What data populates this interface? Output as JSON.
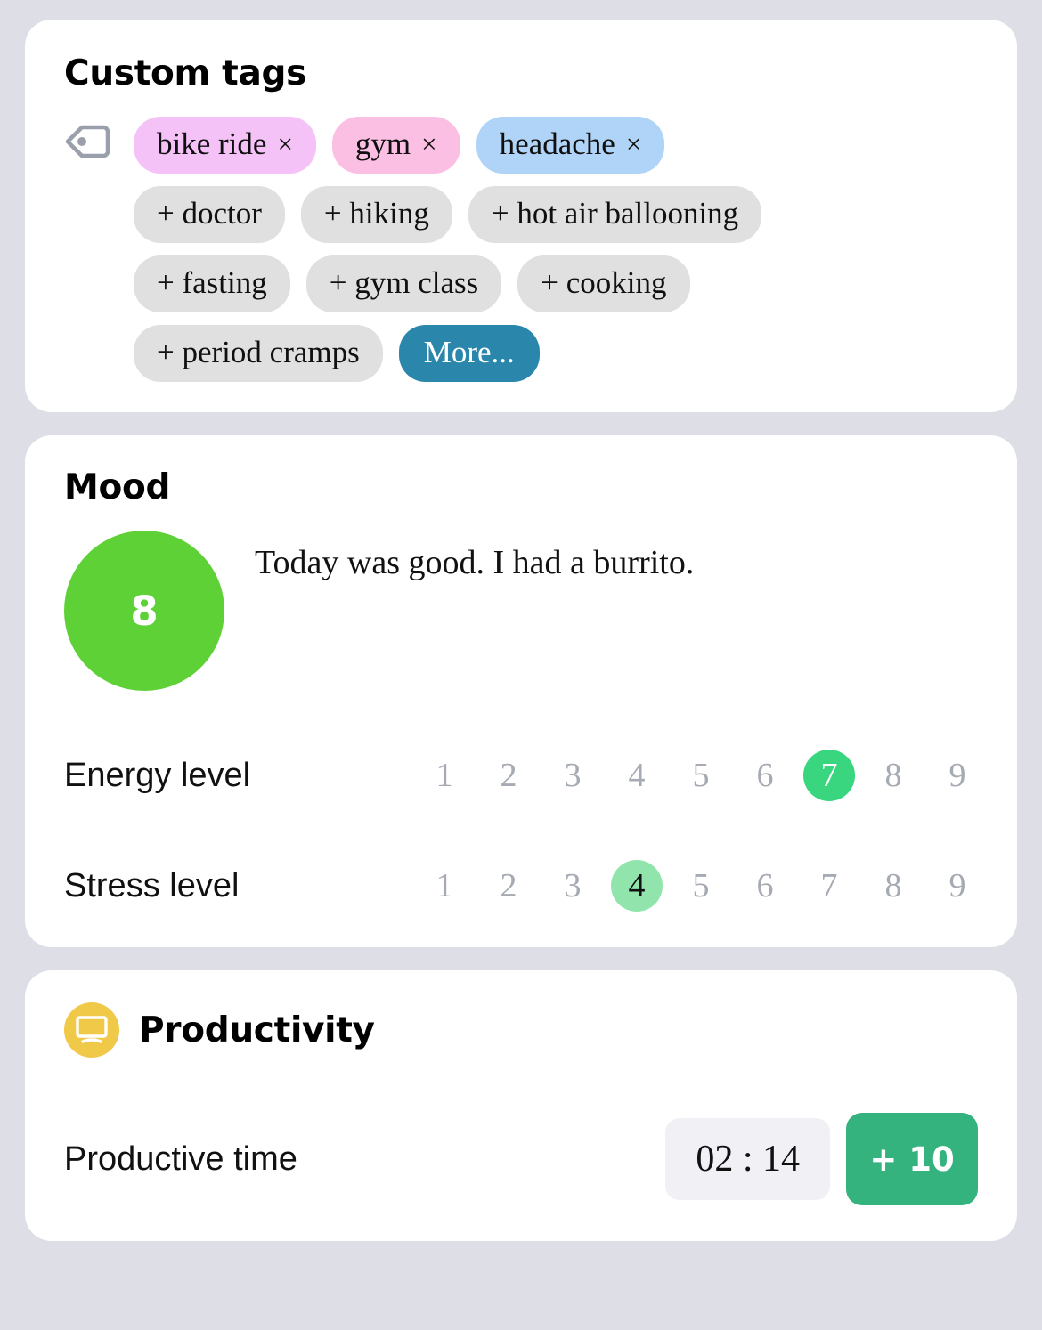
{
  "page": {
    "background_color": "#dedee7",
    "card_color": "#ffffff"
  },
  "custom_tags": {
    "title": "Custom tags",
    "icon": "tag-icon",
    "selected": [
      {
        "label": "bike ride",
        "remove": "×",
        "color": "#f5c2f8"
      },
      {
        "label": "gym",
        "remove": "×",
        "color": "#fcbfe4"
      },
      {
        "label": "headache",
        "remove": "×",
        "color": "#b0d4f7"
      }
    ],
    "suggestions": [
      "+ doctor",
      "+ hiking",
      "+ hot air ballooning",
      "+ fasting",
      "+ gym class",
      "+ cooking",
      "+ period cramps"
    ],
    "more_label": "More...",
    "more_color": "#2a87ab"
  },
  "mood": {
    "title": "Mood",
    "score": "8",
    "score_color": "#5ed136",
    "note": "Today was good. I had a burrito.",
    "energy": {
      "label": "Energy level",
      "options": [
        "1",
        "2",
        "3",
        "4",
        "5",
        "6",
        "7",
        "8",
        "9"
      ],
      "selected": "7",
      "selected_index": 6,
      "selected_color": "#3ad67f"
    },
    "stress": {
      "label": "Stress level",
      "options": [
        "1",
        "2",
        "3",
        "4",
        "5",
        "6",
        "7",
        "8",
        "9"
      ],
      "selected": "4",
      "selected_index": 3,
      "selected_color": "#91e5ac"
    }
  },
  "productivity": {
    "title": "Productivity",
    "icon": "monitor-icon",
    "icon_color": "#f0c949",
    "row_label": "Productive time",
    "time_value": "02 : 14",
    "add_label": "+ 10",
    "add_color": "#35b37e"
  }
}
